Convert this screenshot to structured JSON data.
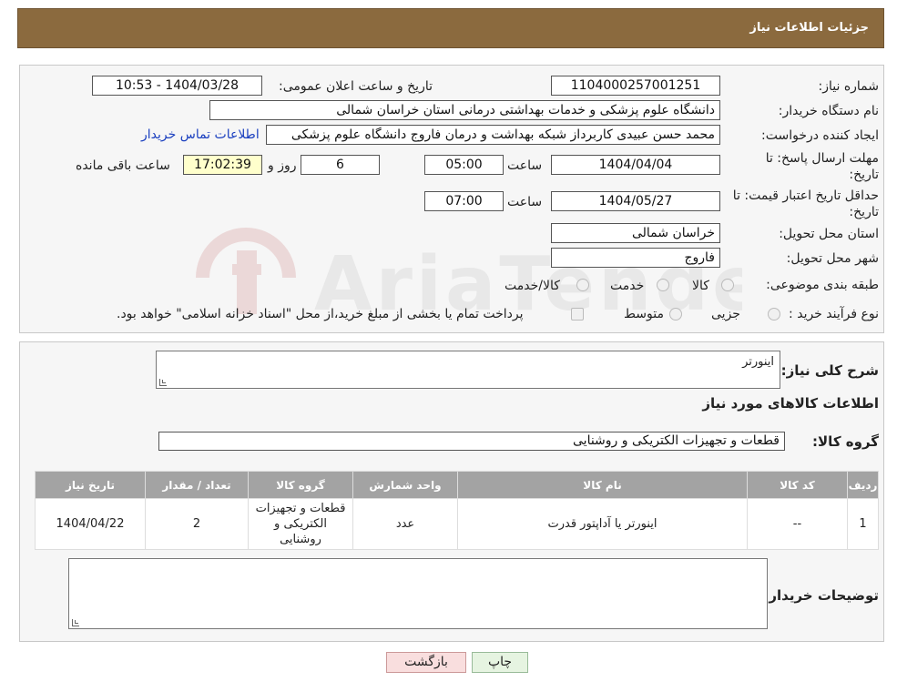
{
  "header": {
    "title": "جزئیات اطلاعات نیاز"
  },
  "form": {
    "need_number_label": "شماره نیاز:",
    "need_number": "1104000257001251",
    "announce_label": "تاریخ و ساعت اعلان عمومی:",
    "announce_value": "1404/03/28 - 10:53",
    "buyer_org_label": "نام دستگاه خریدار:",
    "buyer_org": "دانشگاه علوم پزشکی و خدمات بهداشتی درمانی استان خراسان شمالی",
    "creator_label": "ایجاد کننده درخواست:",
    "creator": "محمد حسن عبیدی کاربرداز شبکه بهداشت و درمان فاروج دانشگاه علوم پزشکی",
    "contact_link": "اطلاعات تماس خریدار",
    "deadline_label": "مهلت ارسال پاسخ: تا تاریخ:",
    "deadline_date": "1404/04/04",
    "time_label": "ساعت",
    "deadline_time": "05:00",
    "days_value": "6",
    "days_label": "روز و",
    "remaining_time": "17:02:39",
    "remaining_label": "ساعت باقی مانده",
    "validity_label": "حداقل تاریخ اعتبار قیمت: تا تاریخ:",
    "validity_date": "1404/05/27",
    "validity_time": "07:00",
    "province_label": "استان محل تحویل:",
    "province": "خراسان شمالی",
    "city_label": "شهر محل تحویل:",
    "city": "فاروج",
    "category_label": "طبقه بندی موضوعی:",
    "category_options": [
      "کالا",
      "خدمت",
      "کالا/خدمت"
    ],
    "process_label": "نوع فرآیند خرید :",
    "process_options": [
      "جزیی",
      "متوسط"
    ],
    "process_note": "پرداخت تمام یا بخشی از مبلغ خرید،از محل \"اسناد خزانه اسلامی\" خواهد بود."
  },
  "details": {
    "summary_label": "شرح کلی نیاز:",
    "summary": "اینورتر",
    "goods_info_title": "اطلاعات کالاهای مورد نیاز",
    "group_label": "گروه کالا:",
    "group_value": "قطعات و تجهیزات الکتریکی و روشنایی",
    "table": {
      "headers": [
        "ردیف",
        "کد کالا",
        "نام کالا",
        "واحد شمارش",
        "گروه کالا",
        "تعداد / مقدار",
        "تاریخ نیاز"
      ],
      "rows": [
        [
          "1",
          "--",
          "اینورتر یا آداپتور قدرت",
          "عدد",
          "قطعات و تجهیزات الکتریکی و روشنایی",
          "2",
          "1404/04/22"
        ]
      ]
    },
    "buyer_notes_label": "توضیحات خریدار:"
  },
  "buttons": {
    "print": "چاپ",
    "back": "بازگشت"
  },
  "colors": {
    "header_bg": "#8b6a3e",
    "table_header_bg": "#a3a3a3",
    "link": "#1a3fbf"
  }
}
